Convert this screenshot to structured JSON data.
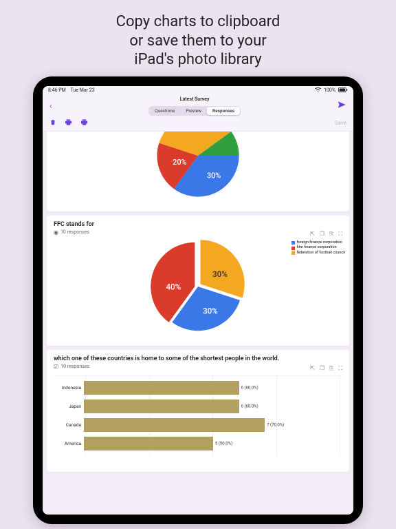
{
  "promo": {
    "line1": "Copy charts to clipboard",
    "line2": "or save them to your",
    "line3": "iPad's photo library"
  },
  "status": {
    "time": "8:46 PM",
    "date": "Tue Mar 23",
    "wifi": "wifi",
    "battery": "100%"
  },
  "nav": {
    "title": "Latest Survey",
    "tabs": {
      "questions": "Questions",
      "preview": "Preview",
      "responses": "Responses"
    }
  },
  "toolbar": {
    "save_label": "Save"
  },
  "card1": {
    "pie_cut_labels": {
      "a": "20%",
      "b": "30%"
    }
  },
  "card2": {
    "title": "FFC stands for",
    "sub": "10 responses",
    "legend": [
      {
        "color": "#3b78e7",
        "label": "foreign finance corporation"
      },
      {
        "color": "#da3b2a",
        "label": "film finance corporation"
      },
      {
        "color": "#f4a720",
        "label": "federation of football council"
      }
    ],
    "pie": {
      "a": "30%",
      "b": "40%",
      "c": "30%"
    }
  },
  "card3": {
    "title": "which one of these countries is home to some of the shortest people in the world.",
    "sub": "10 responses",
    "bars": [
      {
        "cat": "Indonesia",
        "pct": 60,
        "label": "6 (60.0%)"
      },
      {
        "cat": "Japan",
        "pct": 60,
        "label": "6 (60.0%)"
      },
      {
        "cat": "Canada",
        "pct": 70,
        "label": "7 (70.0%)"
      },
      {
        "cat": "America",
        "pct": 50,
        "label": "5 (50.0%)"
      }
    ]
  },
  "chart_data": [
    {
      "type": "pie",
      "title": "",
      "note": "partial pie visible at top of screen",
      "series": [
        {
          "name": "segment-red",
          "value": 20,
          "color": "#da3b2a",
          "label": "20%"
        },
        {
          "name": "segment-blue",
          "value": 30,
          "color": "#3b78e7",
          "label": "30%"
        },
        {
          "name": "segment-green",
          "value": null,
          "color": "#2e9e3f"
        },
        {
          "name": "segment-orange",
          "value": null,
          "color": "#f4a720"
        }
      ]
    },
    {
      "type": "pie",
      "title": "FFC stands for",
      "responses": 10,
      "series": [
        {
          "name": "foreign finance corporation",
          "value": 30,
          "color": "#3b78e7",
          "label": "30%"
        },
        {
          "name": "film finance corporation",
          "value": 40,
          "color": "#da3b2a",
          "label": "40%"
        },
        {
          "name": "federation of football council",
          "value": 30,
          "color": "#f4a720",
          "label": "30%"
        }
      ]
    },
    {
      "type": "bar",
      "orientation": "horizontal",
      "title": "which one of these countries is home to some of the shortest people in the world.",
      "responses": 10,
      "xlabel": "",
      "ylabel": "",
      "xlim": [
        0,
        100
      ],
      "categories": [
        "Indonesia",
        "Japan",
        "Canada",
        "America"
      ],
      "values": [
        60,
        60,
        70,
        50
      ],
      "value_labels": [
        "6 (60.0%)",
        "6 (60.0%)",
        "7 (70.0%)",
        "5 (50.0%)"
      ],
      "bar_color": "#b2a060"
    }
  ]
}
